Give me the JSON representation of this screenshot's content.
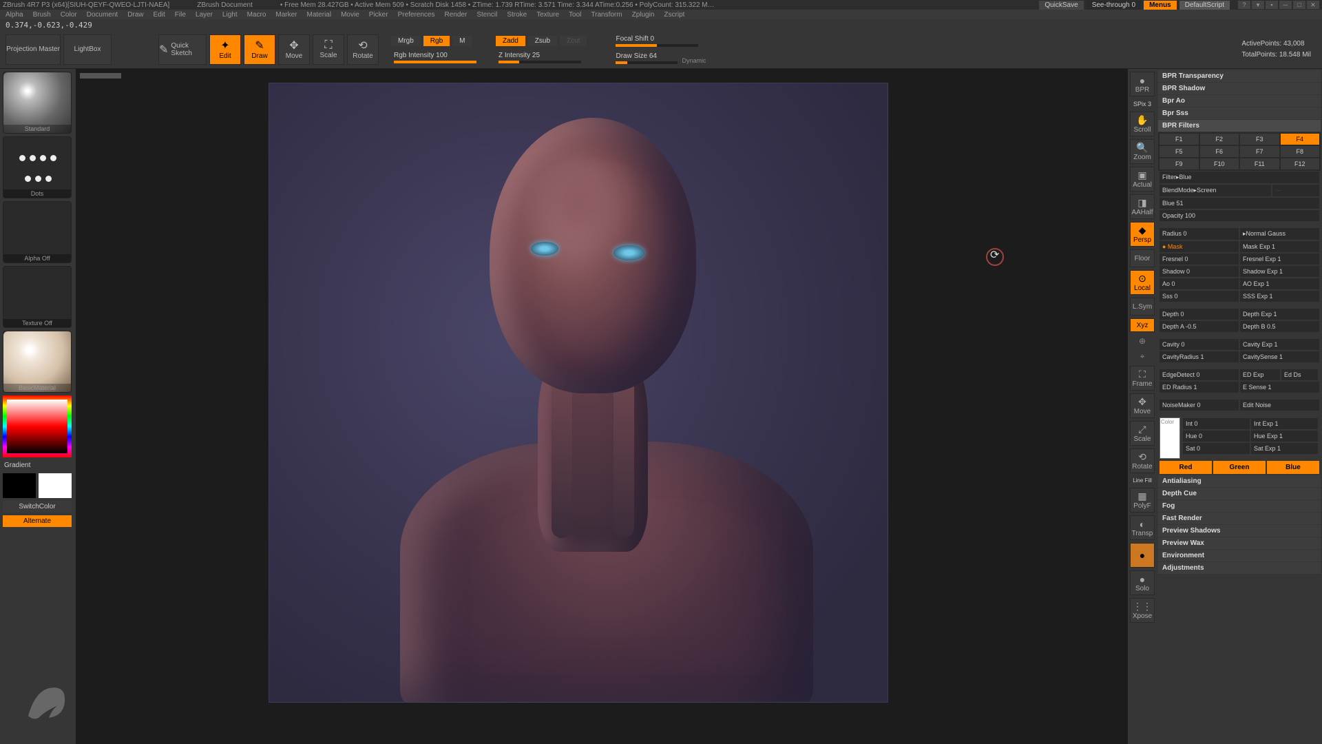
{
  "title": {
    "app": "ZBrush 4R7 P3 (x64)[SIUH-QEYF-QWEO-LJTI-NAEA]",
    "doc": "ZBrush Document",
    "mem": "• Free Mem 28.427GB • Active Mem 509 • Scratch Disk 1458 • ZTime: 1.739 RTime: 3.571 Time: 3.344 ATime:0.256 • PolyCount: 315.322 M…",
    "quicksave": "QuickSave",
    "seethrough": "See-through  0",
    "menus": "Menus",
    "script": "DefaultScript"
  },
  "menu": [
    "Alpha",
    "Brush",
    "Color",
    "Document",
    "Draw",
    "Edit",
    "File",
    "Layer",
    "Light",
    "Macro",
    "Marker",
    "Material",
    "Movie",
    "Picker",
    "Preferences",
    "Render",
    "Stencil",
    "Stroke",
    "Texture",
    "Tool",
    "Transform",
    "Zplugin",
    "Zscript"
  ],
  "coords": "0.374,-0.623,-0.429",
  "toolbar": {
    "projection": "Projection\nMaster",
    "lightbox": "LightBox",
    "quicksketch": "Quick\nSketch",
    "edit": "Edit",
    "draw": "Draw",
    "move": "Move",
    "scale": "Scale",
    "rotate": "Rotate",
    "mrgb": "Mrgb",
    "rgb": "Rgb",
    "m": "M",
    "rgbint": "Rgb Intensity 100",
    "zadd": "Zadd",
    "zsub": "Zsub",
    "zcut": "Zcut",
    "zint": "Z Intensity 25",
    "focal": "Focal Shift 0",
    "drawsize": "Draw Size 64",
    "dynamic": "Dynamic",
    "active": "ActivePoints: 43,008",
    "total": "TotalPoints: 18.548 Mil"
  },
  "left": {
    "brush": "Standard",
    "stroke": "Dots",
    "alpha": "Alpha Off",
    "texture": "Texture Off",
    "material": "BasicMaterial",
    "gradient": "Gradient",
    "switch": "SwitchColor",
    "alternate": "Alternate"
  },
  "nav": {
    "bpr": "BPR",
    "spix": "SPix 3",
    "scroll": "Scroll",
    "zoom": "Zoom",
    "actual": "Actual",
    "aahalf": "AAHalf",
    "persp": "Persp",
    "floor": "Floor",
    "local": "Local",
    "lsym": "L.Sym",
    "xyz": "Xyz",
    "frame": "Frame",
    "move": "Move",
    "scale": "Scale",
    "rotate": "Rotate",
    "polyf": "PolyF",
    "transp": "Transp",
    "ghost": "Ghost",
    "solo": "Solo",
    "xpose": "Xpose",
    "linefill": "Line Fill"
  },
  "panel": {
    "sections": {
      "transparency": "BPR Transparency",
      "shadow": "BPR Shadow",
      "ao": "Bpr Ao",
      "sss": "Bpr Sss",
      "filters": "BPR Filters",
      "aa": "Antialiasing",
      "depthcue": "Depth Cue",
      "fog": "Fog",
      "fast": "Fast Render",
      "pshadows": "Preview Shadows",
      "pwax": "Preview Wax",
      "env": "Environment",
      "adj": "Adjustments"
    },
    "fslots": [
      "F1",
      "F2",
      "F3",
      "F4",
      "F5",
      "F6",
      "F7",
      "F8",
      "F9",
      "F10",
      "F11",
      "F12"
    ],
    "filter": "Filter▸Blue",
    "blend": "BlendMode▸Screen",
    "blue": "Blue 51",
    "opacity": "Opacity 100",
    "radius": "Radius 0",
    "normal": "▸Normal Gauss",
    "mask": "● Mask",
    "maskexp": "Mask Exp 1",
    "fresnel": "Fresnel 0",
    "fresnelexp": "Fresnel Exp 1",
    "shadowp": "Shadow 0",
    "shadowexp": "Shadow Exp 1",
    "aop": "Ao 0",
    "aoexp": "AO Exp 1",
    "sssp": "Sss 0",
    "sssexp": "SSS Exp 1",
    "depth": "Depth 0",
    "depthexp": "Depth Exp 1",
    "deptha": "Depth A -0.5",
    "depthb": "Depth B 0.5",
    "cavity": "Cavity 0",
    "cavityexp": "Cavity Exp 1",
    "cavityr": "CavityRadius 1",
    "cavitys": "CavitySense 1",
    "edge": "EdgeDetect 0",
    "edgeexp": "ED Exp",
    "edds": "Ed Ds",
    "edger": "ED Radius 1",
    "esense": "E Sense 1",
    "noise": "NoiseMaker 0",
    "editnoise": "Edit Noise",
    "int": "Int 0",
    "intexp": "Int Exp 1",
    "hue": "Hue 0",
    "hueexp": "Hue Exp 1",
    "sat": "Sat 0",
    "satexp": "Sat Exp 1",
    "colorlbl": "Color",
    "red": "Red",
    "green": "Green",
    "bluec": "Blue"
  }
}
